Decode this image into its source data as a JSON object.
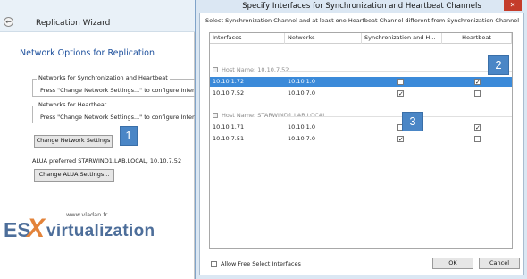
{
  "wizard": {
    "title": "Replication Wizard",
    "heading": "Network Options for Replication",
    "sync_group_legend": "Networks for Synchronization and Heartbeat",
    "sync_group_text": "Press \"Change Network Settings...\" to configure Interfa",
    "hb_group_legend": "Networks for Heartbeat",
    "hb_group_text": "Press \"Change Network Settings...\" to configure Interfac",
    "change_network_button": "Change Network Settings",
    "alua_text": "ALUA preferred STARWIND1.LAB.LOCAL, 10.10.7.52",
    "change_alua_button": "Change ALUA Settings...",
    "back_icon": "←"
  },
  "logo": {
    "url": "www.vladan.fr",
    "es": "ES",
    "x": "X",
    "word": "virtualization"
  },
  "callouts": {
    "one": "1",
    "two": "2",
    "three": "3"
  },
  "dialog": {
    "title": "Specify Interfaces for Synchronization and Heartbeat Channels",
    "close_icon": "✕",
    "instruction": "Select Synchronization Channel and at least one Heartbeat Channel different from Synchronization Channel",
    "columns": {
      "interfaces": "Interfaces",
      "networks": "Networks",
      "sync": "Synchronization and H...",
      "heartbeat": "Heartbeat"
    },
    "groups": [
      {
        "label": "Host Name: 10.10.7.52"
      },
      {
        "label": "Host Name: STARWIND1.LAB.LOCAL"
      }
    ],
    "rows": [
      {
        "interface": "10.10.1.72",
        "network": "10.10.1.0",
        "sync": false,
        "heartbeat": true,
        "selected": true
      },
      {
        "interface": "10.10.7.52",
        "network": "10.10.7.0",
        "sync": true,
        "heartbeat": false,
        "selected": false
      },
      {
        "interface": "10.10.1.71",
        "network": "10.10.1.0",
        "sync": false,
        "heartbeat": true,
        "selected": false
      },
      {
        "interface": "10.10.7.51",
        "network": "10.10.7.0",
        "sync": true,
        "heartbeat": false,
        "selected": false
      }
    ],
    "check_mark": "✓",
    "allow_free_select": "Allow Free Select Interfaces",
    "ok_button": "OK",
    "cancel_button": "Cancel"
  },
  "colors": {
    "accent": "#1c4f9c",
    "selection": "#3b8ad9",
    "callout": "#4a86c6",
    "logo_orange": "#e3833a",
    "logo_blue": "#4d6e9a"
  }
}
